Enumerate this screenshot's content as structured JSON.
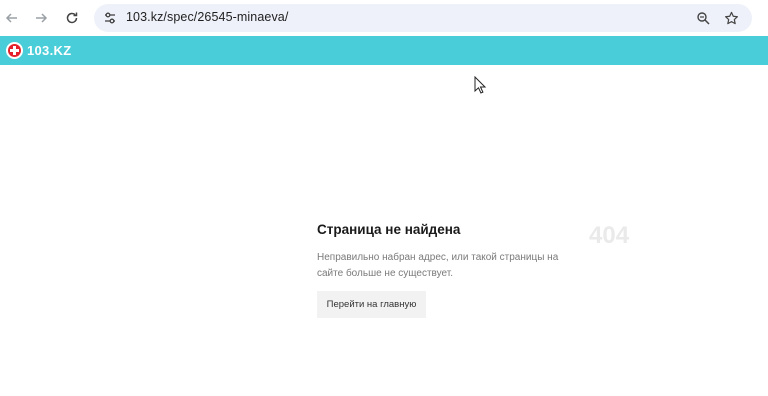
{
  "browser": {
    "url": "103.kz/spec/26545-minaeva/",
    "back_icon": "arrow-left-icon",
    "forward_icon": "arrow-right-icon",
    "reload_icon": "reload-icon",
    "site_info_icon": "tune-icon",
    "zoom_icon": "zoom-icon",
    "bookmark_icon": "star-icon"
  },
  "header": {
    "logo_text": "103.KZ",
    "background_color": "#49cdd8",
    "logo_badge_color": "#e5222b"
  },
  "main": {
    "title": "Страница не найдена",
    "code": "404",
    "description": "Неправильно набран адрес, или такой страницы на сайте больше не существует.",
    "home_button_label": "Перейти на главную"
  }
}
